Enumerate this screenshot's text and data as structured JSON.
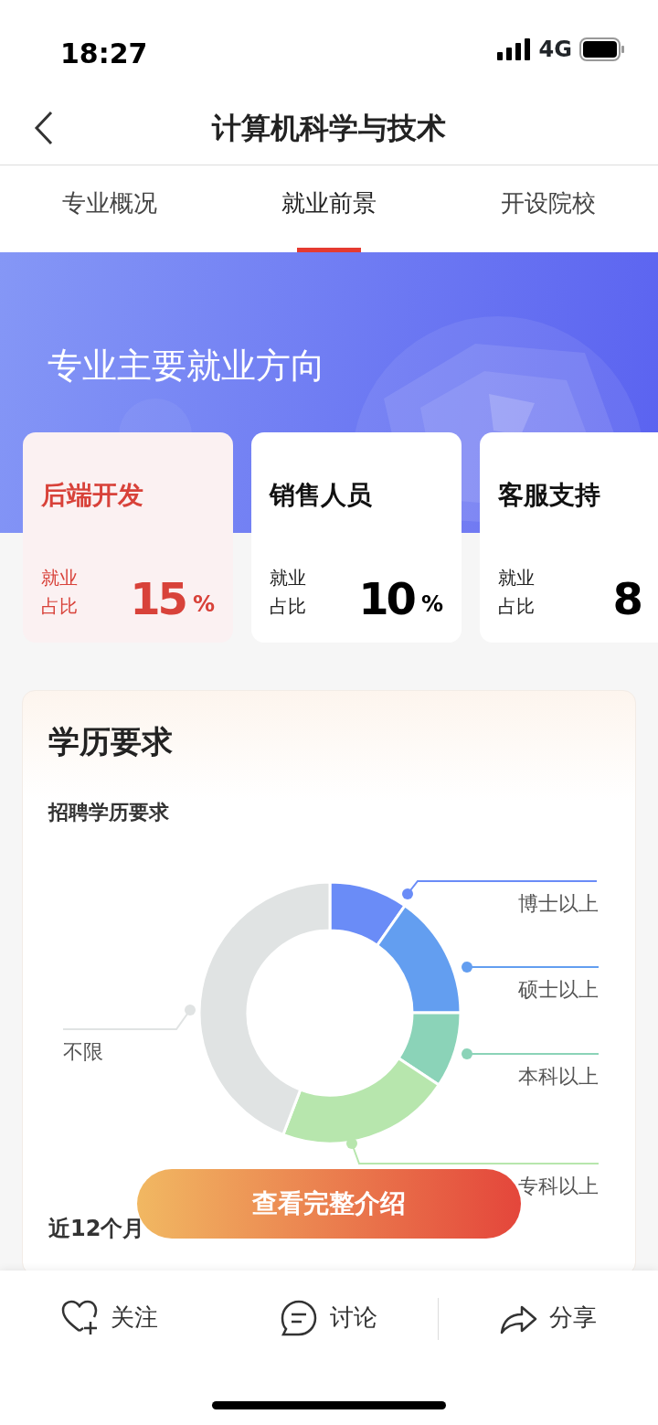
{
  "status_bar": {
    "time": "18:27",
    "network": "4G"
  },
  "header": {
    "title": "计算机科学与技术"
  },
  "tabs": [
    {
      "label": "专业概况",
      "selected": false
    },
    {
      "label": "就业前景",
      "selected": true
    },
    {
      "label": "开设院校",
      "selected": false
    }
  ],
  "hero": {
    "title": "专业主要就业方向"
  },
  "directions": [
    {
      "name": "后端开发",
      "label": "就业占比",
      "value": "15",
      "unit": "%",
      "selected": true
    },
    {
      "name": "销售人员",
      "label": "就业占比",
      "value": "10",
      "unit": "%",
      "selected": false
    },
    {
      "name": "客服支持",
      "label": "就业占比",
      "value": "8",
      "selected": false
    }
  ],
  "education": {
    "title": "学历要求",
    "subtitle": "招聘学历要求",
    "legend": [
      {
        "name": "博士以上",
        "color": "#6a8cf7"
      },
      {
        "name": "硕士以上",
        "color": "#639ef0"
      },
      {
        "name": "本科以上",
        "color": "#8bd3b8"
      },
      {
        "name": "专科以上",
        "color": "#b7e6ad"
      },
      {
        "name": "不限",
        "color": "#e0e3e3"
      }
    ],
    "next_title": "近12个月"
  },
  "cta_button": "查看完整介绍",
  "bottom_bar": [
    {
      "kind": "follow",
      "label": "关注"
    },
    {
      "kind": "discuss",
      "label": "讨论"
    },
    {
      "kind": "share",
      "label": "分享"
    }
  ]
}
